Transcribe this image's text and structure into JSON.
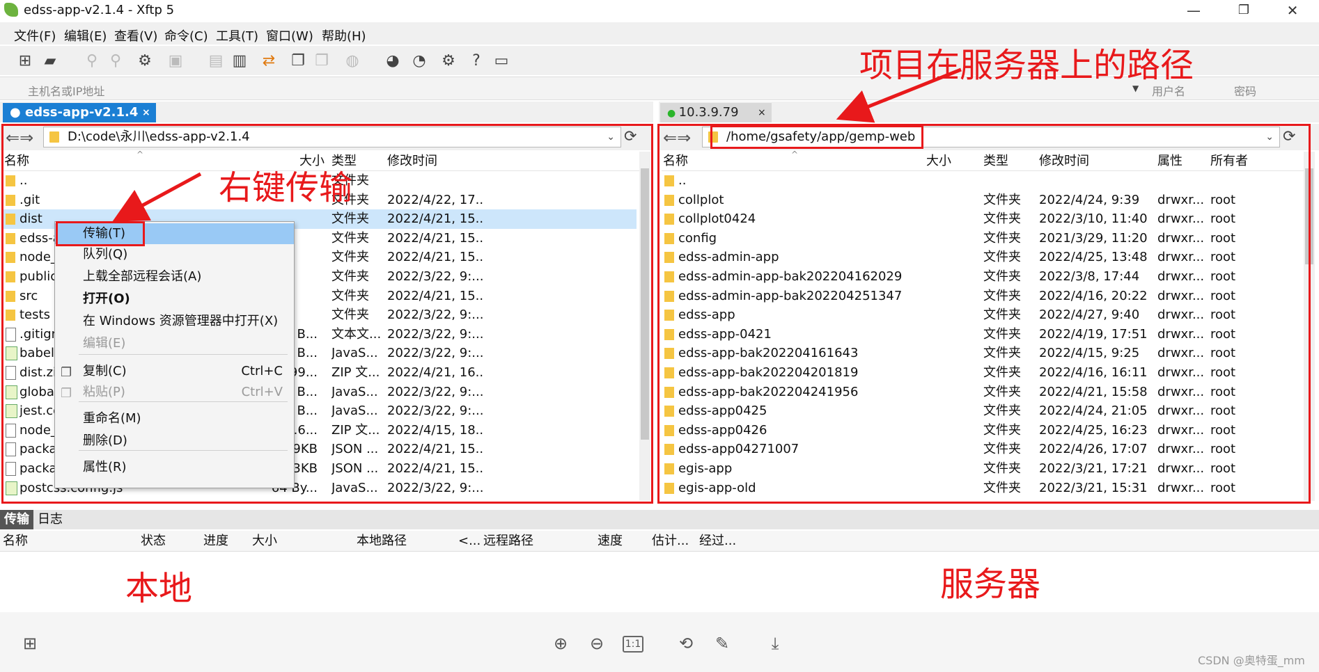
{
  "window": {
    "title": "edss-app-v2.1.4 - Xftp 5",
    "minimize": "—",
    "maximize": "❐",
    "close": "✕"
  },
  "menu": [
    "文件(F)",
    "编辑(E)",
    "查看(V)",
    "命令(C)",
    "工具(T)",
    "窗口(W)",
    "帮助(H)"
  ],
  "address": {
    "host_placeholder": "主机名或IP地址",
    "user_placeholder": "用户名",
    "password_placeholder": "密码"
  },
  "left": {
    "tab": "edss-app-v2.1.4",
    "path": "D:\\code\\永川\\edss-app-v2.1.4",
    "headers": {
      "name": "名称",
      "size": "大小",
      "type": "类型",
      "modified": "修改时间"
    },
    "rows": [
      {
        "icon": "folder",
        "name": "..",
        "size": "",
        "type": "文件夹",
        "modified": ""
      },
      {
        "icon": "folder",
        "name": ".git",
        "size": "",
        "type": "文件夹",
        "modified": "2022/4/22, 17..."
      },
      {
        "icon": "folder",
        "name": "dist",
        "size": "",
        "type": "文件夹",
        "modified": "2022/4/21, 15..."
      },
      {
        "icon": "folder",
        "name": "edss-a",
        "size": "",
        "type": "文件夹",
        "modified": "2022/4/21, 15..."
      },
      {
        "icon": "folder",
        "name": "node_",
        "size": "",
        "type": "文件夹",
        "modified": "2022/4/21, 15..."
      },
      {
        "icon": "folder",
        "name": "public",
        "size": "",
        "type": "文件夹",
        "modified": "2022/3/22, 9:..."
      },
      {
        "icon": "folder",
        "name": "src",
        "size": "",
        "type": "文件夹",
        "modified": "2022/4/21, 15..."
      },
      {
        "icon": "folder",
        "name": "tests",
        "size": "",
        "type": "文件夹",
        "modified": "2022/3/22, 9:..."
      },
      {
        "icon": "file",
        "name": ".gitign",
        "size": "1 B...",
        "type": "文本文...",
        "modified": "2022/3/22, 9:..."
      },
      {
        "icon": "js",
        "name": "babel.",
        "size": "8 B...",
        "type": "JavaS...",
        "modified": "2022/3/22, 9:..."
      },
      {
        "icon": "file",
        "name": "dist.zi",
        "size": ".99...",
        "type": "ZIP 文...",
        "modified": "2022/4/21, 16..."
      },
      {
        "icon": "js",
        "name": "globa",
        "size": "2 B...",
        "type": "JavaS...",
        "modified": "2022/3/22, 9:..."
      },
      {
        "icon": "js",
        "name": "jest.co",
        "size": "3 B...",
        "type": "JavaS...",
        "modified": "2022/3/22, 9:..."
      },
      {
        "icon": "file",
        "name": "node_",
        "size": "4.6...",
        "type": "ZIP 文...",
        "modified": "2022/4/15, 18..."
      },
      {
        "icon": "file",
        "name": "packa",
        "size": "49KB",
        "type": "JSON ...",
        "modified": "2022/4/21, 15..."
      },
      {
        "icon": "file",
        "name": "packa",
        "size": "3KB",
        "type": "JSON ...",
        "modified": "2022/4/21, 15..."
      },
      {
        "icon": "js",
        "name": "postcss.config.js",
        "size": "64 By...",
        "type": "JavaS...",
        "modified": "2022/3/22, 9:..."
      }
    ]
  },
  "context_menu": [
    {
      "label": "传输(T)",
      "shortcut": "",
      "state": "highlighted"
    },
    {
      "label": "队列(Q)",
      "shortcut": "",
      "state": "normal"
    },
    {
      "label": "上载全部远程会话(A)",
      "shortcut": "",
      "state": "normal"
    },
    {
      "label": "打开(O)",
      "shortcut": "",
      "state": "bold"
    },
    {
      "label": "在 Windows 资源管理器中打开(X)",
      "shortcut": "",
      "state": "normal"
    },
    {
      "label": "编辑(E)",
      "shortcut": "",
      "state": "disabled"
    },
    {
      "label": "复制(C)",
      "shortcut": "Ctrl+C",
      "state": "normal"
    },
    {
      "label": "粘贴(P)",
      "shortcut": "Ctrl+V",
      "state": "disabled"
    },
    {
      "label": "重命名(M)",
      "shortcut": "",
      "state": "normal"
    },
    {
      "label": "删除(D)",
      "shortcut": "",
      "state": "normal"
    },
    {
      "label": "属性(R)",
      "shortcut": "",
      "state": "normal"
    }
  ],
  "right": {
    "tab": "10.3.9.79",
    "path": "/home/gsafety/app/gemp-web",
    "headers": {
      "name": "名称",
      "size": "大小",
      "type": "类型",
      "modified": "修改时间",
      "perm": "属性",
      "owner": "所有者"
    },
    "rows": [
      {
        "name": "..",
        "type": "",
        "modified": "",
        "perm": "",
        "owner": ""
      },
      {
        "name": "collplot",
        "type": "文件夹",
        "modified": "2022/4/24, 9:39",
        "perm": "drwxr...",
        "owner": "root"
      },
      {
        "name": "collplot0424",
        "type": "文件夹",
        "modified": "2022/3/10, 11:40",
        "perm": "drwxr...",
        "owner": "root"
      },
      {
        "name": "config",
        "type": "文件夹",
        "modified": "2021/3/29, 11:20",
        "perm": "drwxr...",
        "owner": "root"
      },
      {
        "name": "edss-admin-app",
        "type": "文件夹",
        "modified": "2022/4/25, 13:48",
        "perm": "drwxr...",
        "owner": "root"
      },
      {
        "name": "edss-admin-app-bak202204162029",
        "type": "文件夹",
        "modified": "2022/3/8, 17:44",
        "perm": "drwxr...",
        "owner": "root"
      },
      {
        "name": "edss-admin-app-bak202204251347",
        "type": "文件夹",
        "modified": "2022/4/16, 20:22",
        "perm": "drwxr...",
        "owner": "root"
      },
      {
        "name": "edss-app",
        "type": "文件夹",
        "modified": "2022/4/27, 9:40",
        "perm": "drwxr...",
        "owner": "root"
      },
      {
        "name": "edss-app-0421",
        "type": "文件夹",
        "modified": "2022/4/19, 17:51",
        "perm": "drwxr...",
        "owner": "root"
      },
      {
        "name": "edss-app-bak202204161643",
        "type": "文件夹",
        "modified": "2022/4/15, 9:25",
        "perm": "drwxr...",
        "owner": "root"
      },
      {
        "name": "edss-app-bak202204201819",
        "type": "文件夹",
        "modified": "2022/4/16, 16:11",
        "perm": "drwxr...",
        "owner": "root"
      },
      {
        "name": "edss-app-bak202204241956",
        "type": "文件夹",
        "modified": "2022/4/21, 15:58",
        "perm": "drwxr...",
        "owner": "root"
      },
      {
        "name": "edss-app0425",
        "type": "文件夹",
        "modified": "2022/4/24, 21:05",
        "perm": "drwxr...",
        "owner": "root"
      },
      {
        "name": "edss-app0426",
        "type": "文件夹",
        "modified": "2022/4/25, 16:23",
        "perm": "drwxr...",
        "owner": "root"
      },
      {
        "name": "edss-app04271007",
        "type": "文件夹",
        "modified": "2022/4/26, 17:07",
        "perm": "drwxr...",
        "owner": "root"
      },
      {
        "name": "egis-app",
        "type": "文件夹",
        "modified": "2022/3/21, 17:21",
        "perm": "drwxr...",
        "owner": "root"
      },
      {
        "name": "egis-app-old",
        "type": "文件夹",
        "modified": "2022/3/21, 15:31",
        "perm": "drwxr...",
        "owner": "root"
      }
    ]
  },
  "transfer": {
    "tabs": [
      "传输",
      "日志"
    ],
    "headers": [
      "名称",
      "状态",
      "进度",
      "大小",
      "本地路径",
      "<...",
      "远程路径",
      "速度",
      "估计...",
      "经过..."
    ]
  },
  "annotations": {
    "right_click": "右键传输",
    "server_path": "项目在服务器上的路径",
    "local": "本地",
    "server": "服务器"
  },
  "watermark": "CSDN @奥特蛋_mm",
  "colors": {
    "accent": "#1b7fd4",
    "annotation": "#e8191b",
    "folder": "#f5c542",
    "highlight": "#99c9f5"
  }
}
